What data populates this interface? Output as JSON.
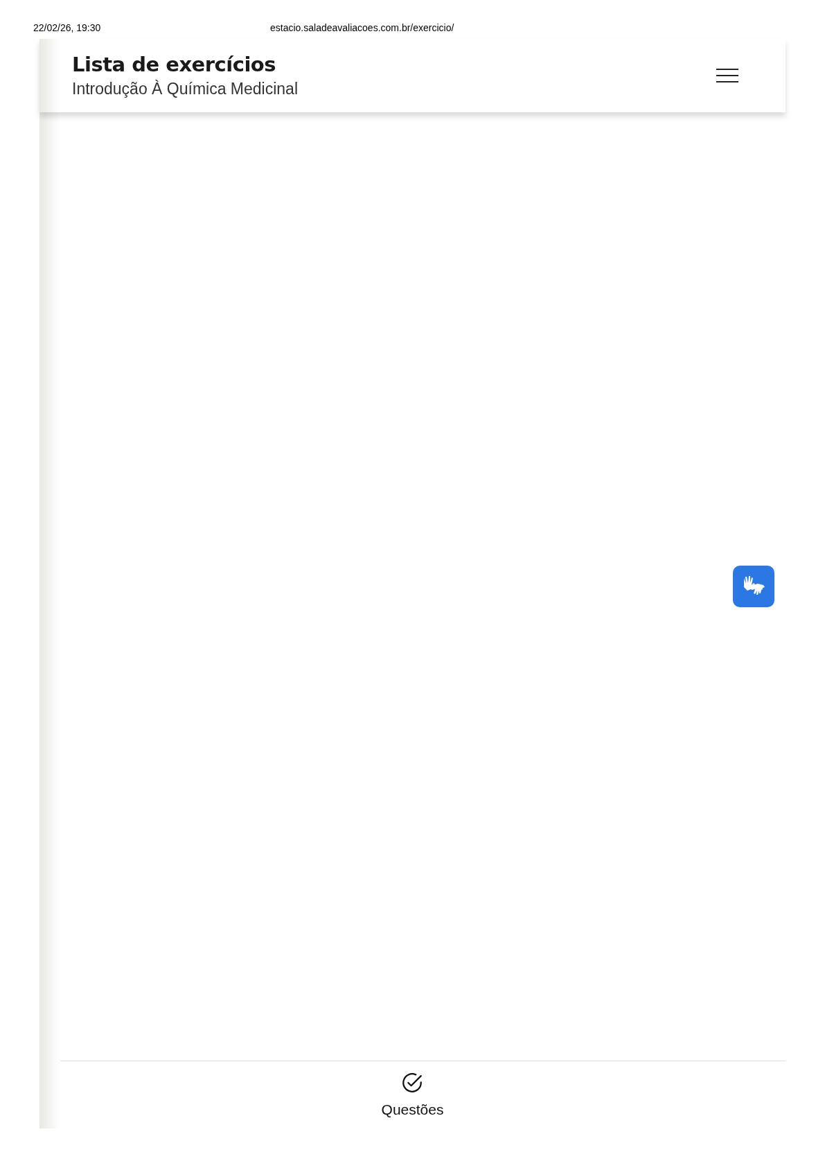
{
  "print_header": {
    "date": "22/02/26, 19:30",
    "url": "estacio.saladeavaliacoes.com.br/exercicio/"
  },
  "header": {
    "title": "Lista de exercícios",
    "subtitle": "Introdução À Química Medicinal"
  },
  "bottom_nav": [
    {
      "label": "Questões"
    }
  ]
}
